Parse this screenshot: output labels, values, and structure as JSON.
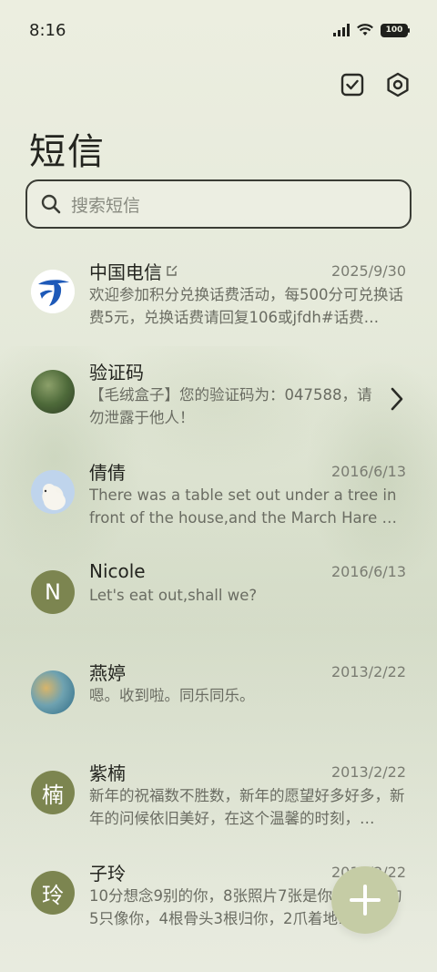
{
  "status": {
    "time": "8:16",
    "battery": "100"
  },
  "header": {
    "title": "短信"
  },
  "search": {
    "placeholder": "搜索短信"
  },
  "conversations": [
    {
      "name": "中国电信",
      "date": "2025/9/30",
      "preview": "欢迎参加积分兑换话费活动，每500分可兑换话费5元，兑换话费请回复106或jfdh#话费…",
      "avatar_type": "telecom-logo"
    },
    {
      "name": "验证码",
      "date": "",
      "preview": "【毛绒盒子】您的验证码为：047588，请勿泄露于他人！",
      "avatar_type": "photo"
    },
    {
      "name": "倩倩",
      "date": "2016/6/13",
      "preview": "There was a table set out under a tree in front of the house,and the March Hare an…",
      "avatar_type": "photo"
    },
    {
      "name": "Nicole",
      "date": "2016/6/13",
      "preview": "Let's eat out,shall we?",
      "avatar_letter": "N"
    },
    {
      "name": "燕婷",
      "date": "2013/2/22",
      "preview": "嗯。收到啦。同乐同乐。",
      "avatar_type": "photo"
    },
    {
      "name": "紫楠",
      "date": "2013/2/22",
      "preview": "新年的祝福数不胜数，新年的愿望好多好多，新年的问候依旧美好，在这个温馨的时刻，…",
      "avatar_letter": "楠"
    },
    {
      "name": "子玲",
      "date": "2013/2/22",
      "preview": "10分想念9别的你，8张照片7张是你，6只小狗5只像你，4根骨头3根归你，2爪着地1宝…",
      "avatar_letter": "玲"
    }
  ],
  "colors": {
    "accent": "#7c8550",
    "fab": "#c5cca5"
  }
}
